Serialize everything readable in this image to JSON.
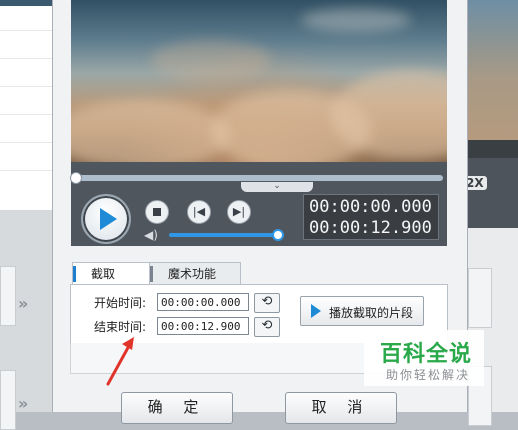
{
  "player": {
    "current_time": "00:00:00.000",
    "total_time": "00:00:12.900",
    "toggle_icon": "chevron-down",
    "volume_level": 1.0,
    "progress": 0.0
  },
  "tabs": [
    {
      "label": "截取",
      "active": true
    },
    {
      "label": "魔术功能",
      "active": false
    }
  ],
  "trim": {
    "start_label": "开始时间:",
    "start_value": "00:00:00.000",
    "end_label": "结束时间:",
    "end_value": "00:00:12.900",
    "play_clip_label": "播放截取的片段"
  },
  "buttons": {
    "ok_label": "确 定",
    "cancel_label": "取 消"
  },
  "background_app": {
    "speed_badge": "2X"
  },
  "watermark": {
    "title": "百科全说",
    "subtitle": "助你轻松解决"
  },
  "colors": {
    "accent": "#1f8ad6",
    "watermark_green": "#2aa94a",
    "arrow_red": "#e0342b"
  }
}
